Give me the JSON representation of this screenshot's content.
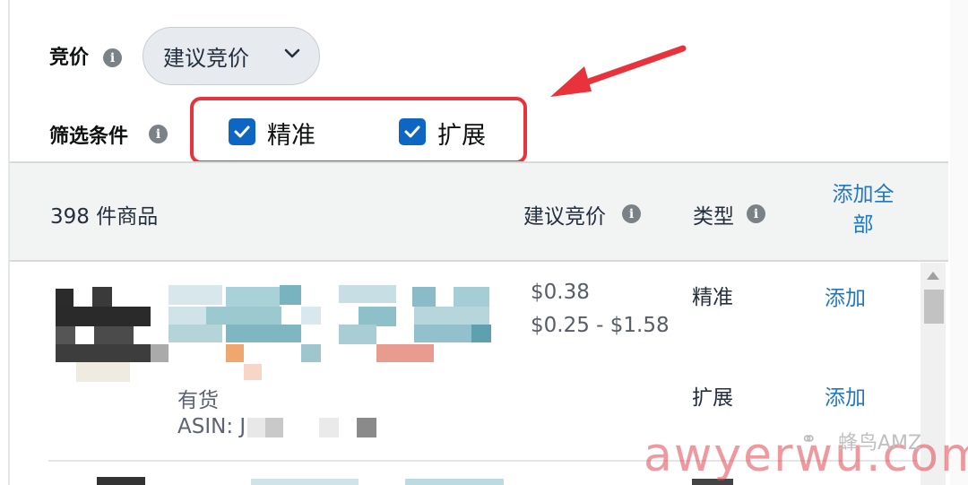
{
  "filters": {
    "bid_label": "竞价",
    "bid_dropdown_value": "建议竞价",
    "filter_label": "筛选条件",
    "checkboxes": [
      {
        "label": "精准",
        "checked": true
      },
      {
        "label": "扩展",
        "checked": true
      }
    ]
  },
  "table": {
    "header": {
      "count": "398 件商品",
      "suggested_bid": "建议竞价",
      "type": "类型",
      "add_all_line1": "添加全",
      "add_all_line2": "部"
    },
    "rows": [
      {
        "stock": "有货",
        "asin_label": "ASIN: J",
        "bid": "$0.38",
        "bid_range": "$0.25 - $1.58",
        "types": [
          {
            "type": "精准",
            "action": "添加"
          },
          {
            "type": "扩展",
            "action": "添加"
          }
        ]
      }
    ]
  },
  "watermark": {
    "brand": "蜂鸟AMZ",
    "url": "awyerwu.com"
  },
  "colors": {
    "checkbox": "#0d66c2",
    "link": "#1f77c6",
    "highlight": "#e8323c"
  }
}
